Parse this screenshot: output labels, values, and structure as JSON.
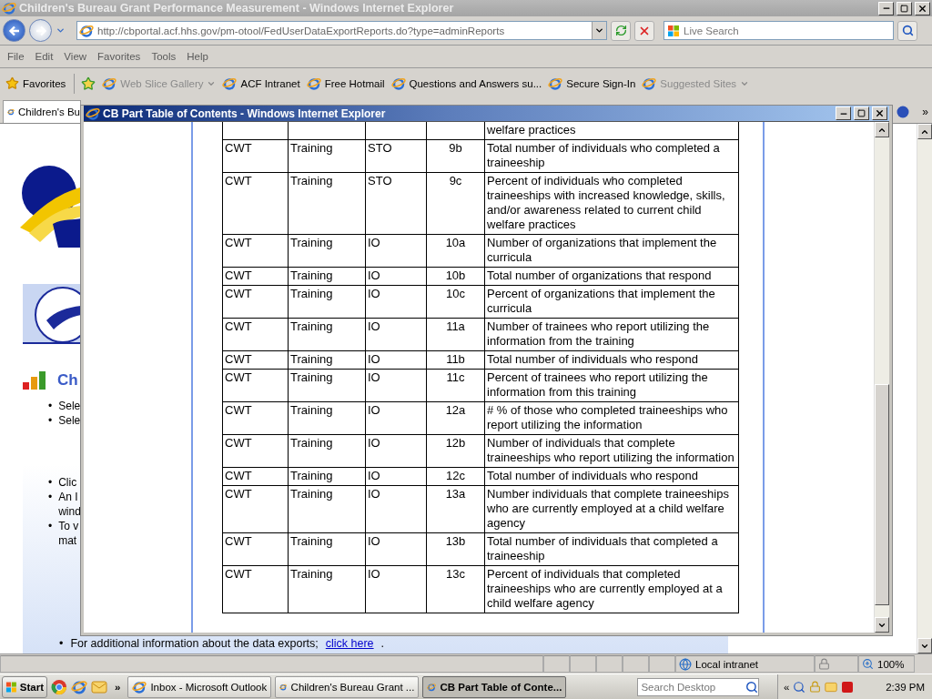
{
  "browser": {
    "title": "Children's Bureau Grant Performance Measurement - Windows Internet Explorer",
    "address": "http://cbportal.acf.hhs.gov/pm-otool/FedUserDataExportReports.do?type=adminReports",
    "search_placeholder": "Live Search",
    "menu": [
      "File",
      "Edit",
      "View",
      "Favorites",
      "Tools",
      "Help"
    ],
    "favorites_label": "Favorites",
    "favorites": [
      {
        "label": "Web Slice Gallery",
        "dimmed": true,
        "dropdown": true
      },
      {
        "label": "ACF Intranet",
        "dimmed": false,
        "dropdown": false
      },
      {
        "label": "Free Hotmail",
        "dimmed": false,
        "dropdown": false
      },
      {
        "label": "Questions and Answers su...",
        "dimmed": false,
        "dropdown": false
      },
      {
        "label": "Secure Sign-In",
        "dimmed": false,
        "dropdown": false
      },
      {
        "label": "Suggested Sites",
        "dimmed": true,
        "dropdown": true
      }
    ],
    "tab": "Children's Bu",
    "overflow": "»"
  },
  "page": {
    "heading": "Ch",
    "bullets_top": [
      {
        "marker": "•",
        "lines": [
          "Sele"
        ]
      },
      {
        "marker": "•",
        "lines": [
          "Sele"
        ]
      }
    ],
    "bullets_bottom": [
      {
        "marker": "•",
        "lines": [
          "Clic"
        ]
      },
      {
        "marker": "•",
        "lines": [
          "An I",
          "wind"
        ]
      },
      {
        "marker": "•",
        "lines": [
          "To v",
          "mat"
        ]
      }
    ],
    "footer": {
      "marker": "•",
      "text": "For additional information about the data exports;",
      "link": "click here",
      "after": "."
    }
  },
  "popup": {
    "title": "CB Part Table of Contents - Windows Internet Explorer",
    "rows": [
      {
        "column_5": "welfare practices"
      },
      {
        "column_1": "CWT",
        "column_2": "Training",
        "column_3": "STO",
        "column_4": "9b",
        "column_5": "Total number of individuals who completed a traineeship"
      },
      {
        "column_1": "CWT",
        "column_2": "Training",
        "column_3": "STO",
        "column_4": "9c",
        "column_5": "Percent of individuals who completed traineeships with increased knowledge, skills, and/or awareness related to current child welfare practices"
      },
      {
        "column_1": "CWT",
        "column_2": "Training",
        "column_3": "IO",
        "column_4": "10a",
        "column_5": "Number of organizations that implement the curricula"
      },
      {
        "column_1": "CWT",
        "column_2": "Training",
        "column_3": "IO",
        "column_4": "10b",
        "column_5": "Total number of organizations that respond"
      },
      {
        "column_1": "CWT",
        "column_2": "Training",
        "column_3": "IO",
        "column_4": "10c",
        "column_5": "Percent of organizations that implement the curricula"
      },
      {
        "column_1": "CWT",
        "column_2": "Training",
        "column_3": "IO",
        "column_4": "11a",
        "column_5": "Number of trainees who report utilizing the information from the training"
      },
      {
        "column_1": "CWT",
        "column_2": "Training",
        "column_3": "IO",
        "column_4": "11b",
        "column_5": "Total number of individuals who respond"
      },
      {
        "column_1": "CWT",
        "column_2": "Training",
        "column_3": "IO",
        "column_4": "11c",
        "column_5": "Percent of trainees who report utilizing the information from this training"
      },
      {
        "column_1": "CWT",
        "column_2": "Training",
        "column_3": "IO",
        "column_4": "12a",
        "column_5": "# % of those who completed traineeships who report utilizing the information"
      },
      {
        "column_1": "CWT",
        "column_2": "Training",
        "column_3": "IO",
        "column_4": "12b",
        "column_5": "Number of individuals that complete traineeships who report utilizing the information"
      },
      {
        "column_1": "CWT",
        "column_2": "Training",
        "column_3": "IO",
        "column_4": "12c",
        "column_5": "Total number of individuals who respond"
      },
      {
        "column_1": "CWT",
        "column_2": "Training",
        "column_3": "IO",
        "column_4": "13a",
        "column_5": "Number individuals that complete traineeships who are currently employed at a child welfare agency"
      },
      {
        "column_1": "CWT",
        "column_2": "Training",
        "column_3": "IO",
        "column_4": "13b",
        "column_5": "Total number of individuals that completed a traineeship"
      },
      {
        "column_1": "CWT",
        "column_2": "Training",
        "column_3": "IO",
        "column_4": "13c",
        "column_5": "Percent of individuals that completed traineeships who are currently employed at a child welfare agency"
      }
    ]
  },
  "status": {
    "zone": "Local intranet",
    "zoom": "100%"
  },
  "taskbar": {
    "start": "Start",
    "overflow": "»",
    "tasks": [
      {
        "label": "Inbox - Microsoft Outlook",
        "selected": false
      },
      {
        "label": "Children's Bureau Grant ...",
        "selected": false
      },
      {
        "label": "CB Part Table of Conte...",
        "selected": true
      }
    ],
    "search_placeholder": "Search Desktop",
    "tray_toggle": "«",
    "clock": "2:39 PM"
  }
}
